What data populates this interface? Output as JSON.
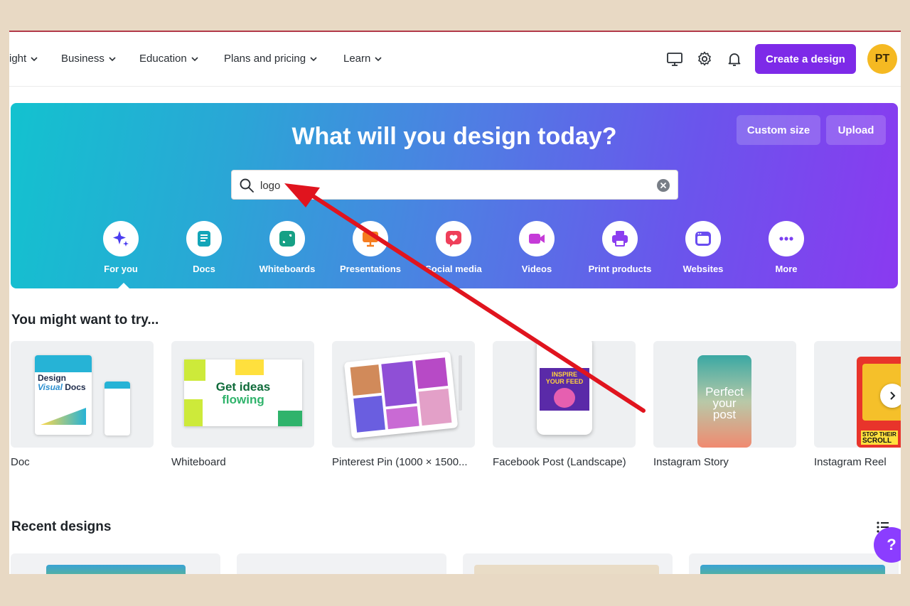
{
  "nav": {
    "items": [
      {
        "label": "ight"
      },
      {
        "label": "Business"
      },
      {
        "label": "Education"
      },
      {
        "label": "Plans and pricing"
      },
      {
        "label": "Learn"
      }
    ],
    "create_label": "Create a design",
    "avatar_initials": "PT"
  },
  "hero": {
    "title": "What will you design today?",
    "custom_size_label": "Custom size",
    "upload_label": "Upload",
    "search_value": "logo",
    "categories": [
      {
        "label": "For you",
        "icon": "sparkle-icon",
        "color": "#5b3df0"
      },
      {
        "label": "Docs",
        "icon": "doc-icon",
        "color": "#13a5b8"
      },
      {
        "label": "Whiteboards",
        "icon": "whiteboard-icon",
        "color": "#16a085"
      },
      {
        "label": "Presentations",
        "icon": "presentation-icon",
        "color": "#f57c1f"
      },
      {
        "label": "Social media",
        "icon": "heart-icon",
        "color": "#ef3f5a"
      },
      {
        "label": "Videos",
        "icon": "video-icon",
        "color": "#c53bd8"
      },
      {
        "label": "Print products",
        "icon": "printer-icon",
        "color": "#8b3df0"
      },
      {
        "label": "Websites",
        "icon": "website-icon",
        "color": "#6a4df0"
      },
      {
        "label": "More",
        "icon": "more-icon",
        "color": "#7b3ff0"
      }
    ]
  },
  "suggestions": {
    "title": "You might want to try...",
    "cards": [
      {
        "label": "Doc"
      },
      {
        "label": "Whiteboard",
        "thumb_text_1": "Get ideas",
        "thumb_text_2": "flowing"
      },
      {
        "label": "Pinterest Pin (1000 × 1500..."
      },
      {
        "label": "Facebook Post (Landscape)",
        "thumb_text_1": "INSPIRE",
        "thumb_text_2": "YOUR FEED"
      },
      {
        "label": "Instagram Story",
        "thumb_text_1": "Perfect",
        "thumb_text_2": "your",
        "thumb_text_3": "post"
      },
      {
        "label": "Instagram Reel",
        "thumb_text_1": "STOP THEIR",
        "thumb_text_2": "SCROLL"
      }
    ]
  },
  "doc_thumb": {
    "line1": "Design",
    "line2": "Visual",
    "line3": "Docs"
  },
  "recent": {
    "title": "Recent designs"
  },
  "help_label": "?",
  "annotation": {
    "arrow_color": "#e0141e"
  }
}
